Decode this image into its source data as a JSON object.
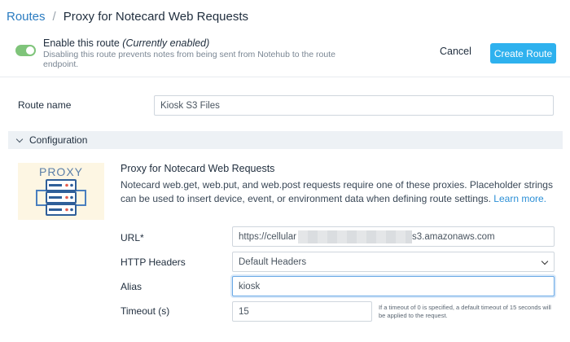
{
  "breadcrumb": {
    "root": "Routes",
    "separator": "/",
    "current": "Proxy for Notecard Web Requests"
  },
  "enable": {
    "label": "Enable this route",
    "status": "(Currently enabled)",
    "description": "Disabling this route prevents notes from being sent from Notehub to the route endpoint.",
    "enabled": true
  },
  "actions": {
    "cancel": "Cancel",
    "create": "Create Route"
  },
  "route_name": {
    "label": "Route name",
    "value": "Kiosk S3 Files"
  },
  "configuration": {
    "section_title": "Configuration",
    "card_label": "PROXY",
    "title": "Proxy for Notecard Web Requests",
    "description": "Notecard web.get, web.put, and web.post requests require one of these proxies. Placeholder strings can be used to insert device, event, or environment data when defining route settings.",
    "learn_more": "Learn more."
  },
  "fields": {
    "url": {
      "label": "URL*",
      "value_prefix": "https://cellular",
      "value_suffix": "s3.amazonaws.com"
    },
    "http_headers": {
      "label": "HTTP Headers",
      "value": "Default Headers"
    },
    "alias": {
      "label": "Alias",
      "value": "kiosk"
    },
    "timeout": {
      "label": "Timeout (s)",
      "value": "15",
      "help": "If a timeout of 0 is specified, a default timeout of 15 seconds will be applied to the request."
    }
  },
  "colors": {
    "accent": "#2eb1ee",
    "link": "#2b7cc1",
    "toggle_on": "#7fc47a",
    "section_bg": "#edf1f5",
    "card_bg": "#fdf6e3"
  }
}
